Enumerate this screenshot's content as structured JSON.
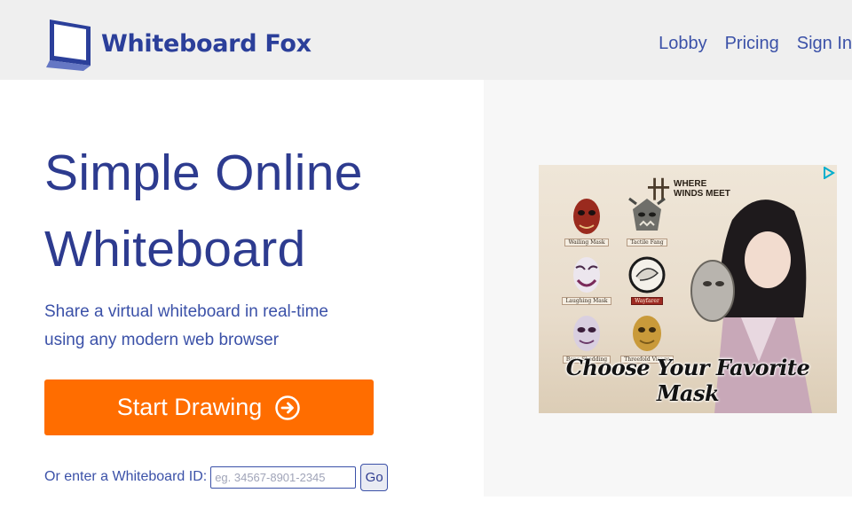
{
  "header": {
    "brand": "Whiteboard Fox",
    "nav": {
      "lobby": "Lobby",
      "pricing": "Pricing",
      "sign_in": "Sign In"
    }
  },
  "hero": {
    "title_line1": "Simple Online",
    "title_line2": "Whiteboard",
    "subtitle_line1": "Share a virtual whiteboard in real-time",
    "subtitle_line2": "using any modern web browser",
    "start_button": "Start Drawing",
    "start_button_icon": "arrow-right-circle-icon"
  },
  "whiteboard_id": {
    "label": "Or enter a Whiteboard ID:",
    "placeholder": "eg. 34567-8901-2345",
    "value": "",
    "go_button": "Go"
  },
  "ad": {
    "brand_line1": "WHERE",
    "brand_line2": "WINDS MEET",
    "masks": [
      {
        "name": "Wailing Mask"
      },
      {
        "name": "Tactile Fang"
      },
      {
        "name": "Laughing Mask"
      },
      {
        "name": "Wayfarer",
        "selected": true
      },
      {
        "name": "Bone Shedding"
      },
      {
        "name": "Threefold Visage"
      }
    ],
    "tagline": "Choose Your Favorite Mask"
  },
  "colors": {
    "brand_blue": "#2d3b8f",
    "link_blue": "#3b51a8",
    "start_button": "#ff6d00",
    "header_bg": "#efefef"
  }
}
